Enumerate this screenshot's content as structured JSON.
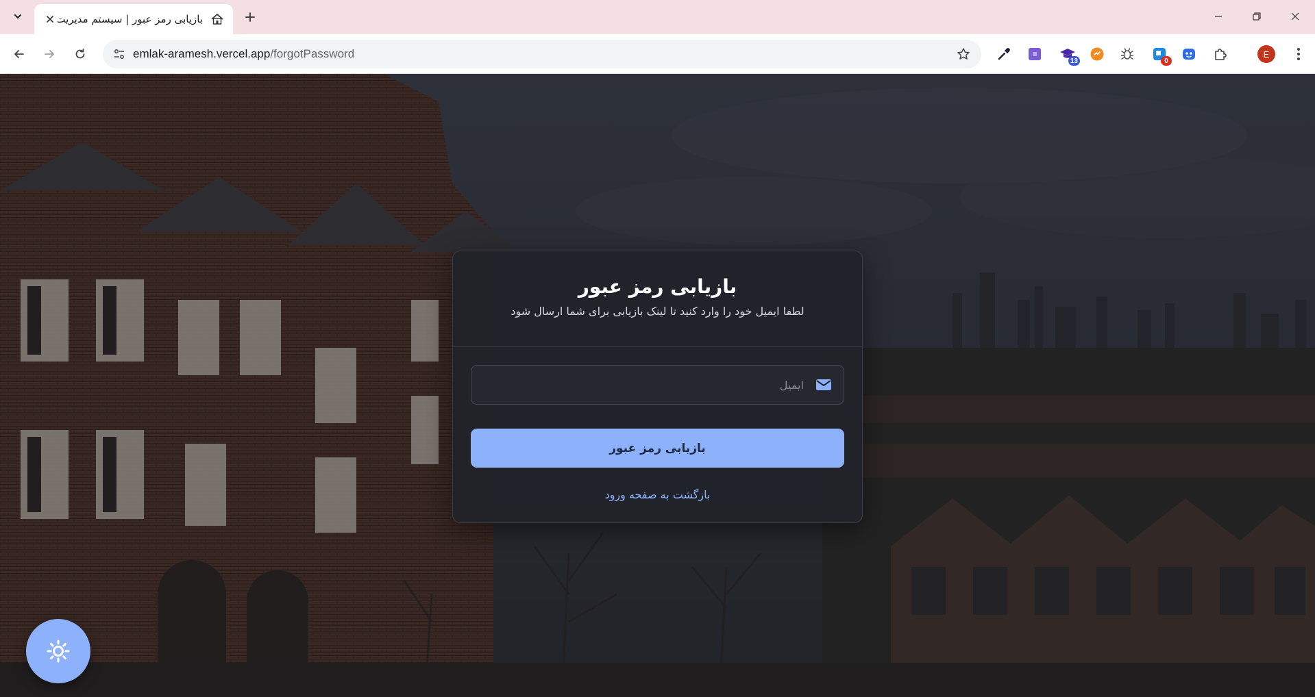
{
  "browser": {
    "tab": {
      "title": "بازیابی رمز عبور | سیستم مدیریت",
      "favicon": "house-icon"
    },
    "url": {
      "host": "emlak-aramesh.vercel.app",
      "path": "/forgotPassword"
    },
    "extensions": [
      {
        "name": "eyedropper-icon"
      },
      {
        "name": "purple-square-extension-icon"
      },
      {
        "name": "graduation-cap-extension-icon",
        "badge": "13",
        "badge_color": "#3b5bdb"
      },
      {
        "name": "orange-circle-extension-icon"
      },
      {
        "name": "bug-extension-icon"
      },
      {
        "name": "blue-square-extension-icon",
        "badge": "0",
        "badge_color": "#d93025"
      },
      {
        "name": "blue-face-extension-icon"
      },
      {
        "name": "puzzle-icon"
      }
    ],
    "profile_initial": "E",
    "colors": {
      "tabstrip": "#f4dfe2",
      "profile": "#c1351d"
    }
  },
  "card": {
    "title": "بازیابی رمز عبور",
    "subtitle": "لطفا ایمیل خود را وارد کنید تا لینک بازیابی برای شما ارسال شود",
    "email": {
      "placeholder": "ایمیل",
      "value": "",
      "icon": "envelope-icon"
    },
    "submit_label": "بازیابی رمز عبور",
    "back_link_label": "بازگشت به صفحه ورود"
  },
  "theme_toggle": {
    "icon": "sun-icon"
  },
  "colors": {
    "accent": "#8db1fb",
    "card_bg": "#21232a",
    "link": "#8fb3fb"
  }
}
